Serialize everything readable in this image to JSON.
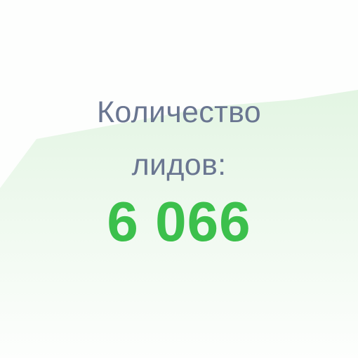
{
  "metric": {
    "label_line1": "Количество",
    "label_line2": "лидов:",
    "value": "6 066"
  },
  "colors": {
    "label": "#6a7691",
    "value": "#3cc04c",
    "background_shape": "#dff3df"
  }
}
